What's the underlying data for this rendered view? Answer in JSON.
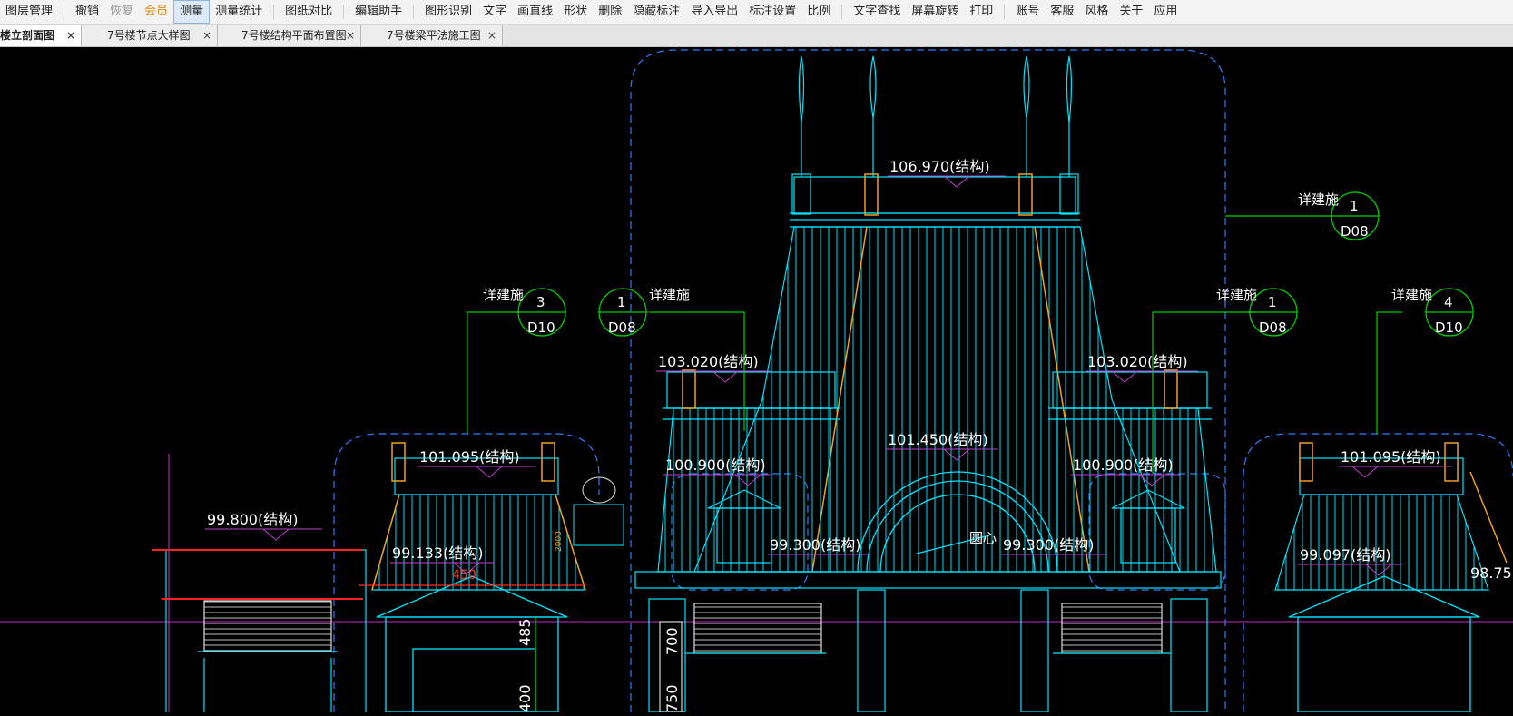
{
  "menu": {
    "items": [
      {
        "label": "图层管理",
        "state": "normal"
      },
      {
        "label": "撤销",
        "state": "normal"
      },
      {
        "label": "恢复",
        "state": "disabled"
      },
      {
        "label": "会员",
        "state": "vip"
      },
      {
        "label": "测量",
        "state": "active"
      },
      {
        "label": "测量统计",
        "state": "normal"
      },
      {
        "label": "图纸对比",
        "state": "normal"
      },
      {
        "label": "编辑助手",
        "state": "normal"
      },
      {
        "label": "图形识别",
        "state": "normal"
      },
      {
        "label": "文字",
        "state": "normal"
      },
      {
        "label": "画直线",
        "state": "normal"
      },
      {
        "label": "形状",
        "state": "normal"
      },
      {
        "label": "删除",
        "state": "normal"
      },
      {
        "label": "隐藏标注",
        "state": "normal"
      },
      {
        "label": "导入导出",
        "state": "normal"
      },
      {
        "label": "标注设置",
        "state": "normal"
      },
      {
        "label": "比例",
        "state": "normal"
      },
      {
        "label": "文字查找",
        "state": "normal"
      },
      {
        "label": "屏幕旋转",
        "state": "normal"
      },
      {
        "label": "打印",
        "state": "normal"
      },
      {
        "label": "账号",
        "state": "normal"
      },
      {
        "label": "客服",
        "state": "normal"
      },
      {
        "label": "风格",
        "state": "normal"
      },
      {
        "label": "关于",
        "state": "normal"
      },
      {
        "label": "应用",
        "state": "normal"
      }
    ]
  },
  "tabs": [
    {
      "label": "楼立剖面图",
      "active": true
    },
    {
      "label": "7号楼节点大样图",
      "active": false
    },
    {
      "label": "7号楼结构平面布置图",
      "active": false
    },
    {
      "label": "7号楼梁平法施工图",
      "active": false
    }
  ],
  "tab_close_glyph": "×",
  "drawing": {
    "elevations": [
      "106.970(结构)",
      "103.020(结构)",
      "103.020(结构)",
      "101.450(结构)",
      "101.095(结构)",
      "101.095(结构)",
      "100.900(结构)",
      "100.900(结构)",
      "99.800(结构)",
      "99.300(结构)",
      "99.300(结构)",
      "99.133(结构)",
      "99.097(结构)",
      "98.75"
    ],
    "detail_callouts": [
      {
        "text": "详建施",
        "num": "3",
        "sheet": "D10"
      },
      {
        "text": "详建施",
        "num": "1",
        "sheet": "D08"
      },
      {
        "text": "详建施",
        "num": "1",
        "sheet": "D08"
      },
      {
        "text": "详建施",
        "num": "1",
        "sheet": "D08"
      },
      {
        "text": "详建施",
        "num": "4",
        "sheet": "D10"
      }
    ],
    "center_label": "圆心",
    "dims": [
      "450",
      "2000",
      "700",
      "750",
      "485",
      "400"
    ],
    "colors": {
      "background": "#000000",
      "cyan": "#00e5ff",
      "blue": "#2f7cff",
      "green": "#00d000",
      "white": "#ffffff",
      "orange": "#f0a020",
      "magenta": "#d040d0",
      "red": "#ff2020"
    }
  }
}
